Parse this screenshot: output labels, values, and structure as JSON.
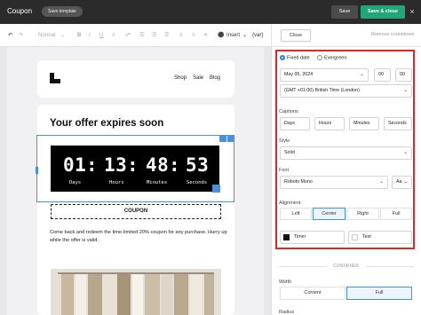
{
  "topbar": {
    "title": "Coupon",
    "template_button": "Save template",
    "save": "Save",
    "save_close": "Save & close",
    "close_icon": "×"
  },
  "toolbar": {
    "font_label": "Normal",
    "insert_label": "Insert",
    "var_label": "{var}",
    "close": "Close",
    "remove_countdown": "Remove countdown"
  },
  "email": {
    "nav": [
      "Shop",
      "Sale",
      "Blog"
    ],
    "headline": "Your offer expires soon",
    "timer": {
      "values": [
        "01",
        "13",
        "48",
        "53"
      ],
      "separator": ":",
      "labels": [
        "Days",
        "Hours",
        "Minutes",
        "Seconds"
      ]
    },
    "coupon": "COUPON",
    "body": "Come back and redeem the time-limited 20% coupon for any purchase. Hurry up while the offer is valid."
  },
  "panel": {
    "date_modes": [
      "Fixed date",
      "Evergreen"
    ],
    "selected_mode": "Fixed date",
    "date": "May 05, 2024",
    "hour": "00",
    "minute": "00",
    "timezone": "(GMT +01:00) British Time (London)",
    "captions_label": "Captions",
    "captions": [
      "Days",
      "Hours",
      "Minutes",
      "Seconds"
    ],
    "style_label": "Style",
    "style_value": "Solid",
    "font_label": "Font",
    "font_value": "Roboto Mono",
    "font_size_icon": "Aa",
    "alignment_label": "Alignment",
    "alignment": [
      "Left",
      "Center",
      "Right",
      "Full"
    ],
    "selected_alignment": "Center",
    "timer_color_label": "Timer",
    "text_color_label": "Text",
    "timer_color": "#111111",
    "text_color": "#ffffff",
    "container_label": "CONTAINER",
    "width_label": "Width",
    "width_options": [
      "Content",
      "Full"
    ],
    "selected_width": "Full",
    "radius_label": "Radius"
  },
  "colors": {
    "accent": "#21a67a",
    "selection": "#4a90e2",
    "highlight": "#d92a2a"
  }
}
